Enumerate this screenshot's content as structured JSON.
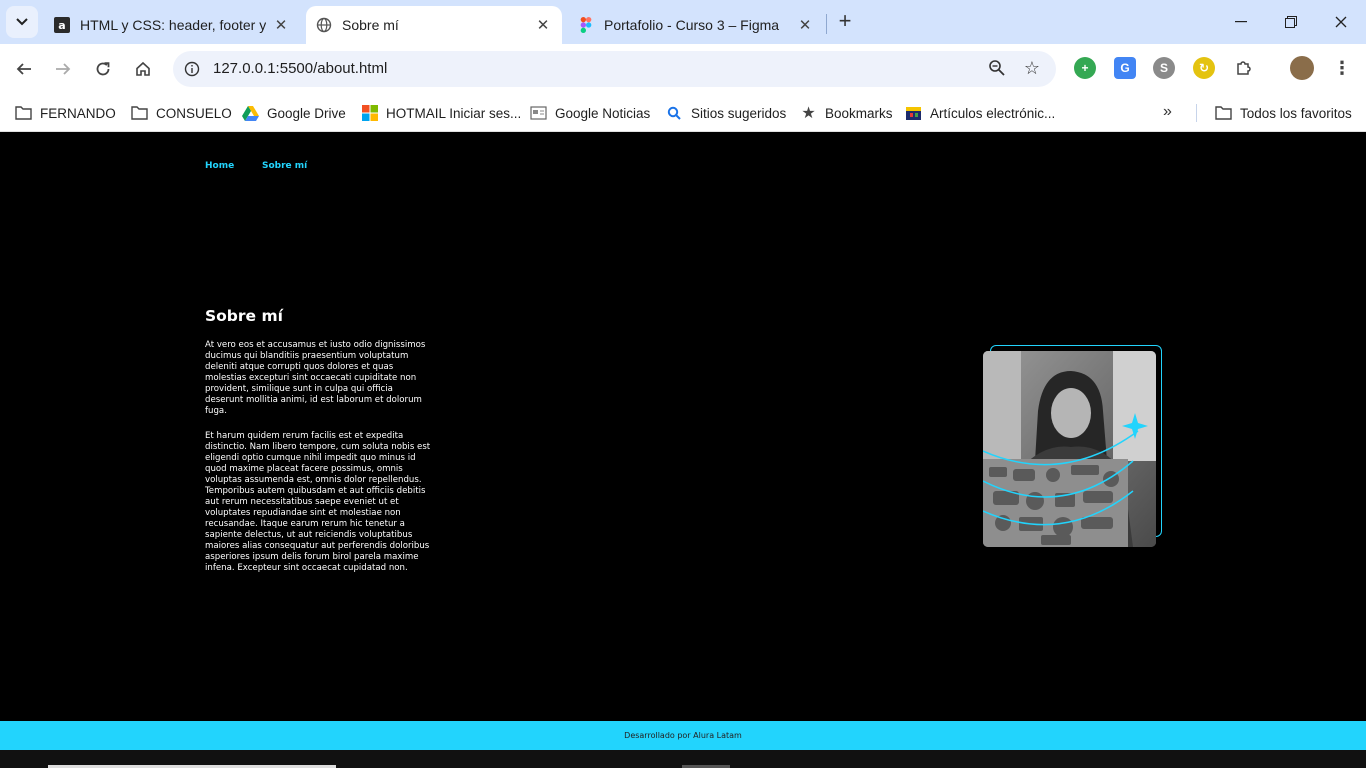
{
  "browser": {
    "tabs": [
      {
        "title": "HTML y CSS: header, footer y va",
        "favicon": "alura-icon"
      },
      {
        "title": "Sobre mí",
        "favicon": "globe-icon"
      },
      {
        "title": "Portafolio - Curso 3 – Figma",
        "favicon": "figma-icon"
      }
    ],
    "url": "127.0.0.1:5500/about.html",
    "bookmarks": [
      {
        "label": "FERNANDO",
        "icon": "folder-icon"
      },
      {
        "label": "CONSUELO",
        "icon": "folder-icon"
      },
      {
        "label": "Google Drive",
        "icon": "google-drive-icon"
      },
      {
        "label": "HOTMAIL Iniciar ses...",
        "icon": "microsoft-icon"
      },
      {
        "label": "Google Noticias",
        "icon": "news-icon"
      },
      {
        "label": "Sitios sugeridos",
        "icon": "search-icon"
      },
      {
        "label": "Bookmarks",
        "icon": "star-icon"
      },
      {
        "label": "Artículos electrónic...",
        "icon": "store-icon"
      }
    ],
    "all_bookmarks": "Todos los favoritos"
  },
  "page": {
    "nav": {
      "home": "Home",
      "about": "Sobre mí"
    },
    "title": "Sobre mí",
    "paragraphs": [
      "At vero eos et accusamus et iusto odio dignissimos ducimus qui blanditiis praesentium voluptatum deleniti atque corrupti quos dolores et quas molestias excepturi sint occaecati cupiditate non provident, similique sunt in culpa qui officia deserunt mollitia animi, id est laborum et dolorum fuga.",
      "Et harum quidem rerum facilis est et expedita distinctio. Nam libero tempore, cum soluta nobis est eligendi optio cumque nihil impedit quo minus id quod maxime placeat facere possimus, omnis voluptas assumenda est, omnis dolor repellendus. Temporibus autem quibusdam et aut officiis debitis aut rerum necessitatibus saepe eveniet ut et voluptates repudiandae sint et molestiae non recusandae. Itaque earum rerum hic tenetur a sapiente delectus, ut aut reiciendis voluptatibus maiores alias consequatur aut perferendis doloribus asperiores ipsum delis forum birol parela maxime infena. Excepteur sint occaecat cupidatad non."
    ],
    "footer": "Desarrollado por Alura Latam"
  },
  "colors": {
    "accent": "#22d4fd",
    "background": "#000000",
    "tabstrip": "#d3e3fd"
  }
}
